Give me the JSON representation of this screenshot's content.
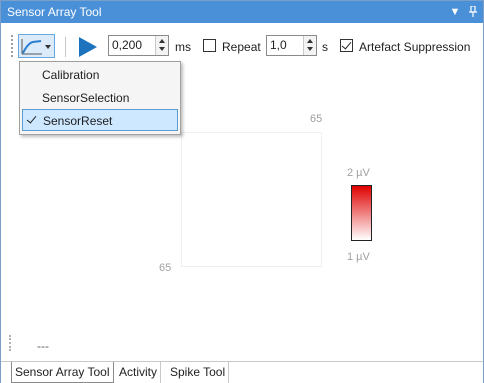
{
  "window": {
    "title": "Sensor Array Tool",
    "titlebar_color": "#4a90d9",
    "buttons": [
      {
        "name": "dropdown",
        "glyph": "▾"
      },
      {
        "name": "pin",
        "glyph": "⊥"
      }
    ]
  },
  "toolbar": {
    "mode_icon": "curve-icon",
    "delay_value": "0,200",
    "delay_unit": "ms",
    "repeat_label": "Repeat",
    "repeat_checked": false,
    "repeat_value": "1,0",
    "repeat_unit": "s",
    "artefact_label": "Artefact Suppression",
    "artefact_checked": true,
    "play_color": "#1e73be"
  },
  "menu": {
    "items": [
      {
        "label": "Calibration",
        "checked": false
      },
      {
        "label": "SensorSelection",
        "checked": false
      },
      {
        "label": "SensorReset",
        "checked": true
      }
    ]
  },
  "plot": {
    "top_tick": "65",
    "left_tick": "65",
    "colorbar_max": "2 µV",
    "colorbar_min": "1 µV",
    "colorbar_top_color": "#e00000",
    "colorbar_bottom_color": "#ffffff"
  },
  "status": {
    "text": "---"
  },
  "tabs": [
    {
      "label": "Sensor Array Tool",
      "active": true
    },
    {
      "label": "Activity",
      "active": false
    },
    {
      "label": "Spike Tool",
      "active": false
    }
  ]
}
